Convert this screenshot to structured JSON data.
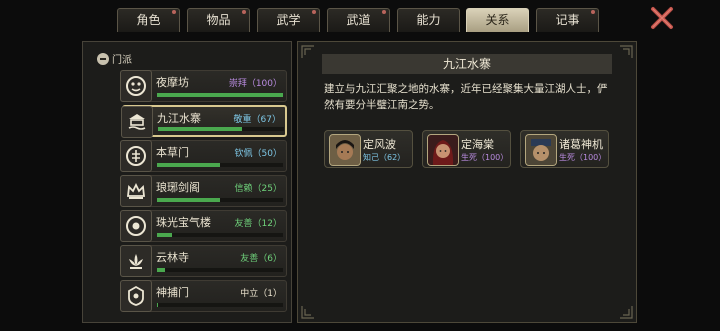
{
  "tabs": [
    {
      "label": "角色",
      "dot": true
    },
    {
      "label": "物品",
      "dot": true
    },
    {
      "label": "武学",
      "dot": true
    },
    {
      "label": "武道",
      "dot": true
    },
    {
      "label": "能力",
      "dot": false
    },
    {
      "label": "关系",
      "dot": false,
      "active": true
    },
    {
      "label": "记事",
      "dot": true
    }
  ],
  "left": {
    "section_label": "门派",
    "sects": [
      {
        "name": "夜摩坊",
        "relation": "崇拜（100）",
        "color": "#b98be0",
        "fill": 1.0
      },
      {
        "name": "九江水寨",
        "relation": "敬重（67）",
        "color": "#7ec7e6",
        "fill": 0.67,
        "selected": true
      },
      {
        "name": "本草门",
        "relation": "钦佩（50）",
        "color": "#7ec7e6",
        "fill": 0.5
      },
      {
        "name": "琅琊剑阁",
        "relation": "信赖（25）",
        "color": "#6fd27b",
        "fill": 0.5
      },
      {
        "name": "珠光宝气楼",
        "relation": "友善（12）",
        "color": "#6fd27b",
        "fill": 0.12
      },
      {
        "name": "云林寺",
        "relation": "友善（6）",
        "color": "#6fd27b",
        "fill": 0.06
      },
      {
        "name": "神捕门",
        "relation": "中立（1）",
        "color": "#ebe3ce",
        "fill": 0.01
      }
    ]
  },
  "detail": {
    "title": "九江水寨",
    "description": "建立与九江汇聚之地的水寨，近年已经聚集大量江湖人士，俨然有要分半璧江南之势。",
    "npcs": [
      {
        "name": "定风波",
        "relation": "知己（62）",
        "color": "#7ec7e6",
        "skin": "#a57a55",
        "hair": "#1a1613"
      },
      {
        "name": "定海棠",
        "relation": "生死（100）",
        "color": "#b98be0",
        "skin": "#c89272",
        "hair": "#6e1a1a"
      },
      {
        "name": "诸葛神机",
        "relation": "生死（100）",
        "color": "#b98be0",
        "skin": "#b5906a",
        "hair": "#2a3a55"
      }
    ]
  },
  "colors": {
    "accent": "#d8c88f",
    "bar": "#4aa84e",
    "close": "#c0524a"
  }
}
